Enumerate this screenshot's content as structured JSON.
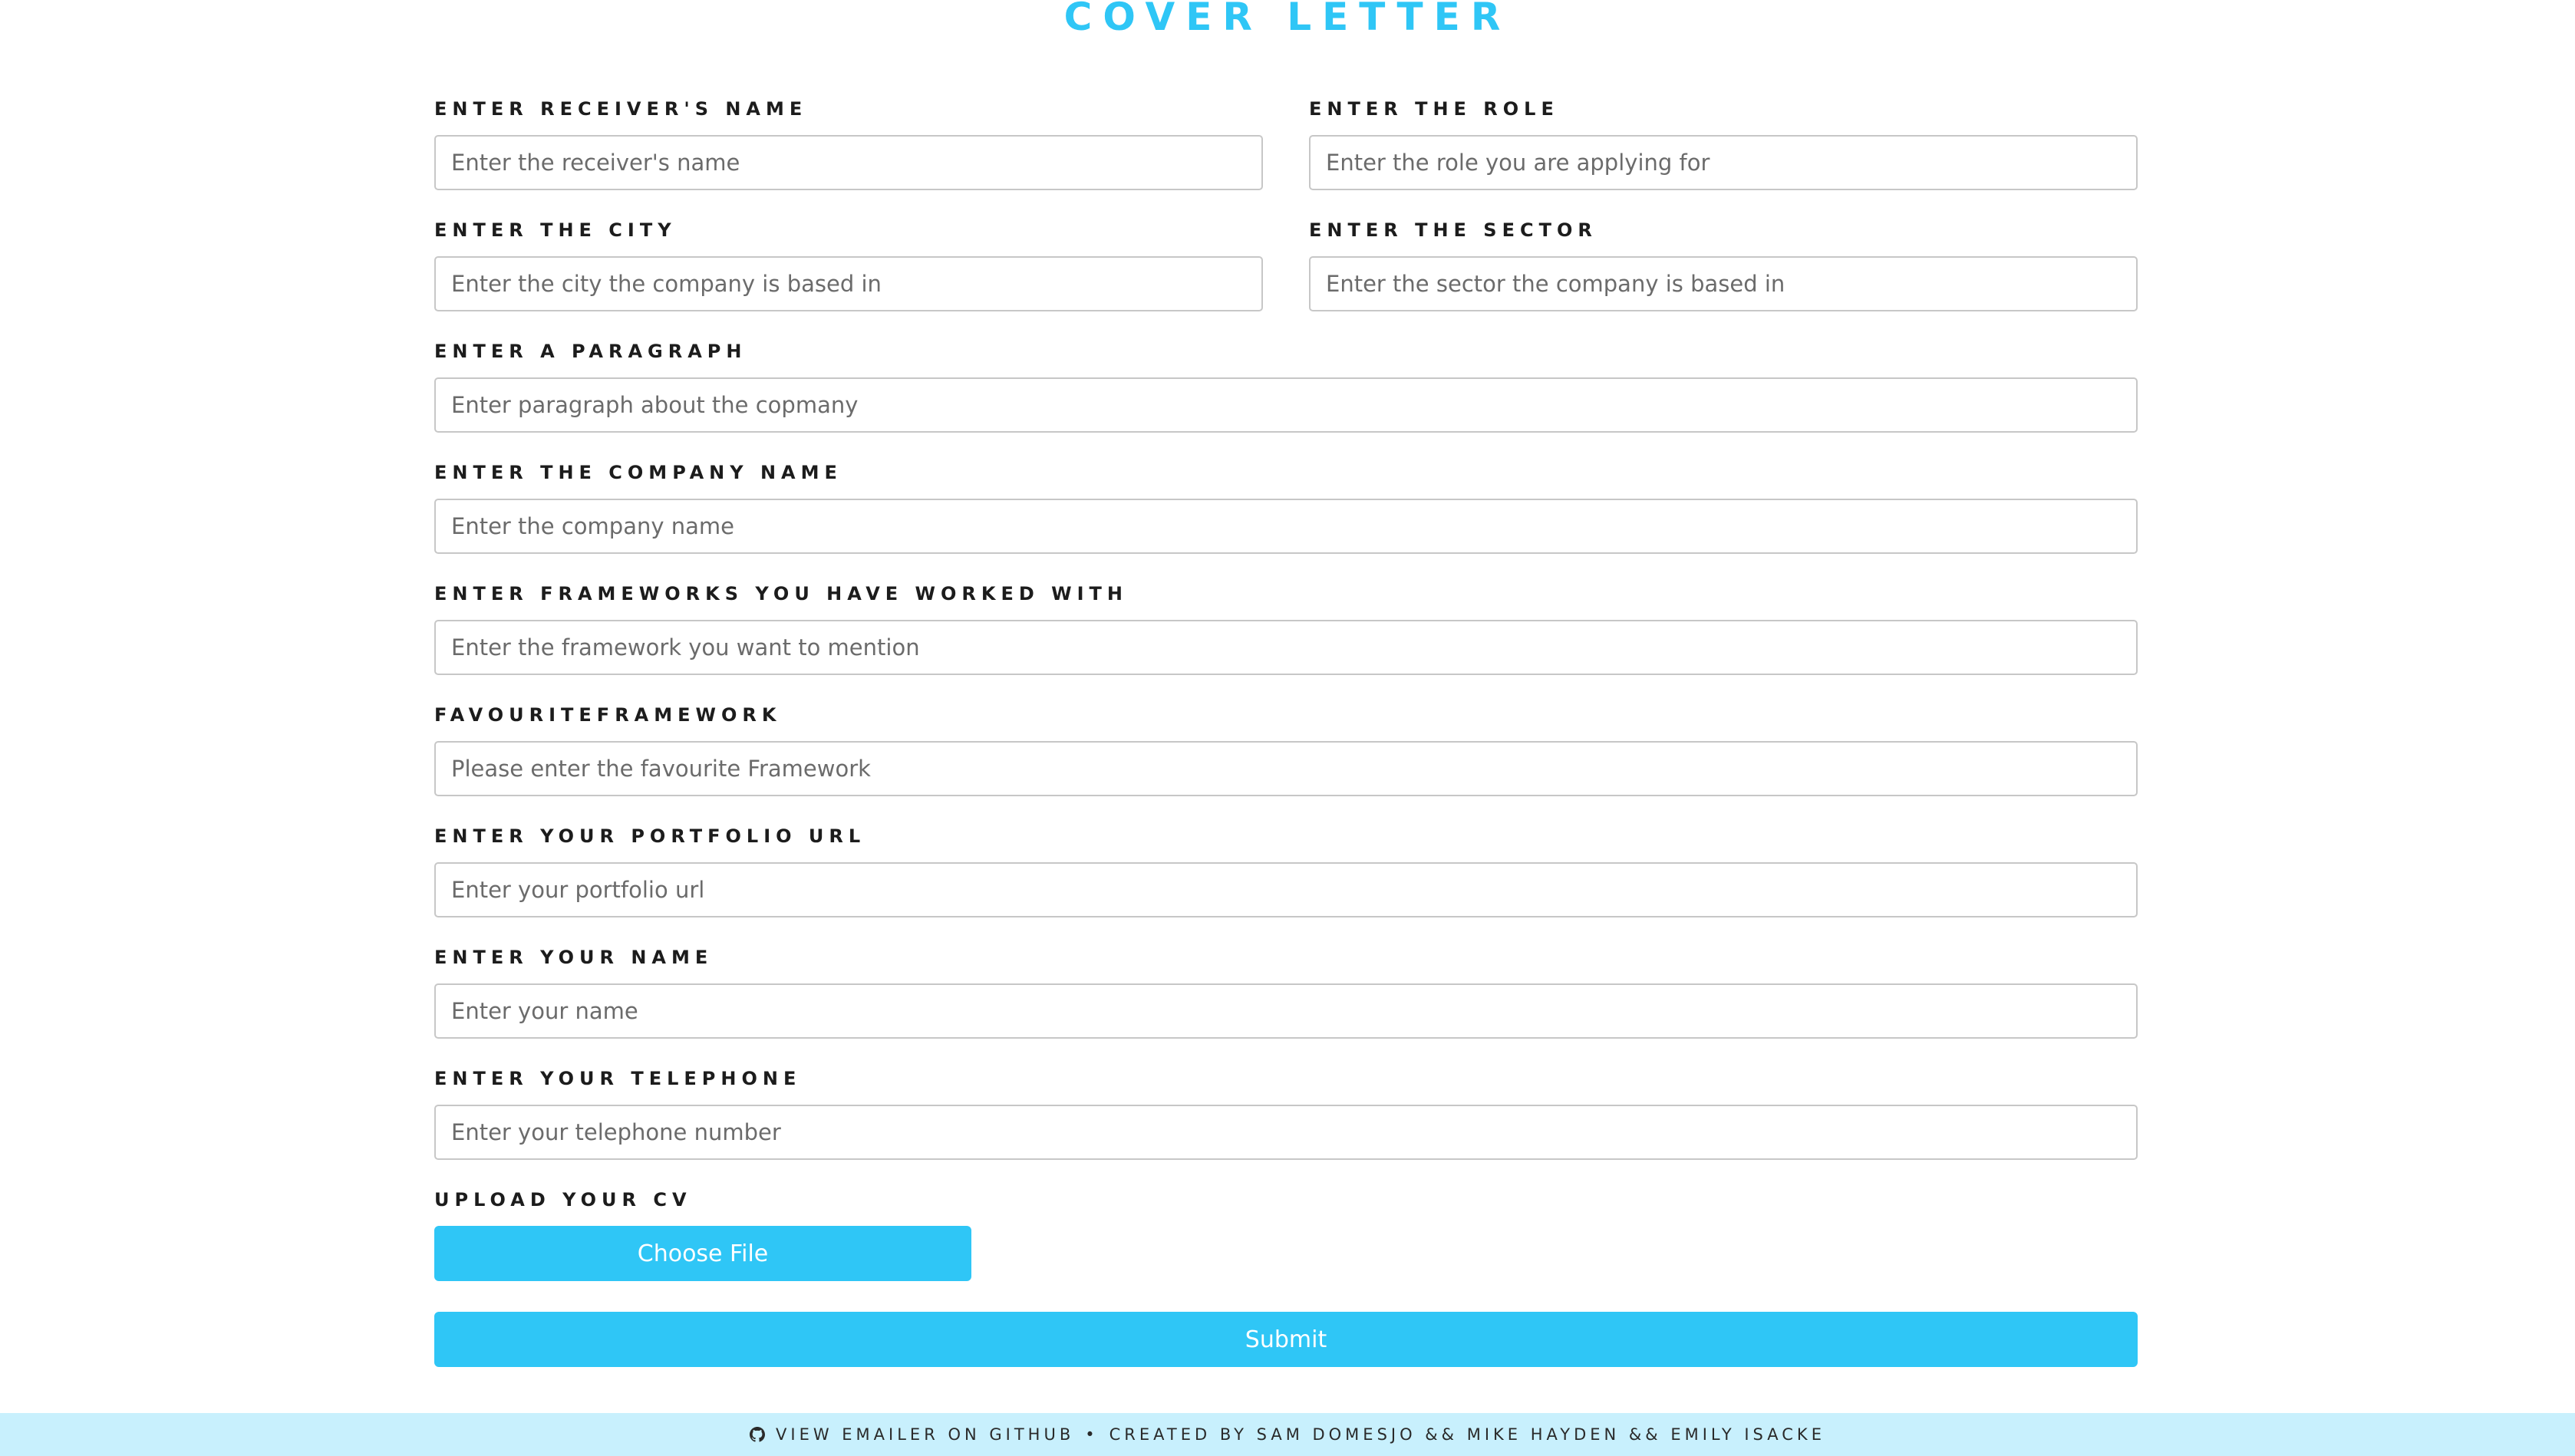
{
  "page": {
    "title": "COVER LETTER"
  },
  "fields": {
    "receiver_name": {
      "label": "ENTER RECEIVER'S NAME",
      "placeholder": "Enter the receiver's name",
      "value": ""
    },
    "role": {
      "label": "ENTER THE ROLE",
      "placeholder": "Enter the role you are applying for",
      "value": ""
    },
    "city": {
      "label": "ENTER THE CITY",
      "placeholder": "Enter the city the company is based in",
      "value": ""
    },
    "sector": {
      "label": "ENTER THE SECTOR",
      "placeholder": "Enter the sector the company is based in",
      "value": ""
    },
    "paragraph": {
      "label": "ENTER A PARAGRAPH",
      "placeholder": "Enter paragraph about the copmany",
      "value": ""
    },
    "company_name": {
      "label": "ENTER THE COMPANY NAME",
      "placeholder": "Enter the company name",
      "value": ""
    },
    "frameworks": {
      "label": "ENTER FRAMEWORKS YOU HAVE WORKED WITH",
      "placeholder": "Enter the framework you want to mention",
      "value": ""
    },
    "favourite_framework": {
      "label": "FAVOURITEFRAMEWORK",
      "placeholder": "Please enter the favourite Framework",
      "value": ""
    },
    "portfolio_url": {
      "label": "ENTER YOUR PORTFOLIO URL",
      "placeholder": "Enter your portfolio url",
      "value": ""
    },
    "your_name": {
      "label": "ENTER YOUR NAME",
      "placeholder": "Enter your name",
      "value": ""
    },
    "telephone": {
      "label": "ENTER YOUR TELEPHONE",
      "placeholder": "Enter your telephone number",
      "value": ""
    },
    "cv": {
      "label": "UPLOAD YOUR CV",
      "button_label": "Choose File"
    }
  },
  "actions": {
    "submit_label": "Submit"
  },
  "footer": {
    "link_text": "VIEW EMAILER ON GITHUB",
    "separator": "•",
    "credits": "CREATED BY SAM DOMESJO && MIKE HAYDEN && EMILY ISACKE",
    "icon": "github-icon"
  },
  "colors": {
    "accent": "#2fc6f6",
    "footer_bg": "#c8f0fd",
    "label_text": "#1c1c1c",
    "input_border": "#c7c7c7"
  }
}
